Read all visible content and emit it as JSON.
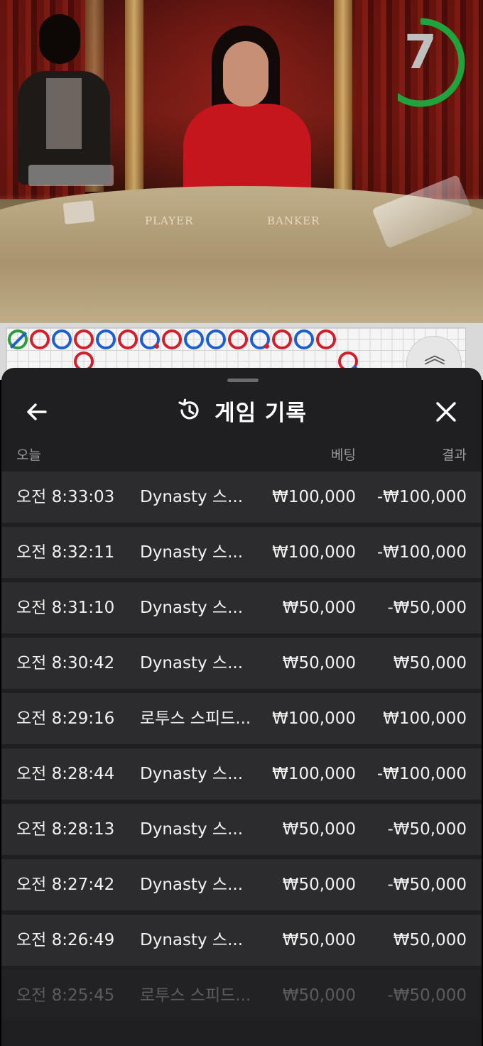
{
  "video": {
    "countdown": "7",
    "countdown_progress": 0.7,
    "table_labels": [
      "PLAYER",
      "BANKER"
    ]
  },
  "roadmap": {
    "row1": [
      "tie-slash",
      "red",
      "blue",
      "red",
      "blue",
      "red",
      "blue-dot",
      "red",
      "blue",
      "blue",
      "red",
      "blue-dot",
      "red",
      "blue",
      "red"
    ],
    "row2": [
      {
        "col": 3,
        "color": "red"
      },
      {
        "col": 15,
        "color": "red-dot"
      }
    ],
    "colors": {
      "player": "#1d5fd0",
      "banker": "#d21f2b",
      "tie": "#2b9b3b"
    }
  },
  "sheet": {
    "title": "게임 기록",
    "back_icon": "arrow-left-icon",
    "history_icon": "history-icon",
    "close_icon": "close-icon",
    "columns": {
      "date": "오늘",
      "bet": "베팅",
      "result": "결과"
    },
    "rows": [
      {
        "time": "오전 8:33:03",
        "game": "Dynasty 스...",
        "bet": "₩100,000",
        "result": "-₩100,000"
      },
      {
        "time": "오전 8:32:11",
        "game": "Dynasty 스...",
        "bet": "₩100,000",
        "result": "-₩100,000"
      },
      {
        "time": "오전 8:31:10",
        "game": "Dynasty 스...",
        "bet": "₩50,000",
        "result": "-₩50,000"
      },
      {
        "time": "오전 8:30:42",
        "game": "Dynasty 스...",
        "bet": "₩50,000",
        "result": "₩50,000"
      },
      {
        "time": "오전 8:29:16",
        "game": "로투스 스피드...",
        "bet": "₩100,000",
        "result": "₩100,000"
      },
      {
        "time": "오전 8:28:44",
        "game": "Dynasty 스...",
        "bet": "₩100,000",
        "result": "-₩100,000"
      },
      {
        "time": "오전 8:28:13",
        "game": "Dynasty 스...",
        "bet": "₩50,000",
        "result": "-₩50,000"
      },
      {
        "time": "오전 8:27:42",
        "game": "Dynasty 스...",
        "bet": "₩50,000",
        "result": "-₩50,000"
      },
      {
        "time": "오전 8:26:49",
        "game": "Dynasty 스...",
        "bet": "₩50,000",
        "result": "₩50,000"
      },
      {
        "time": "오전 8:25:45",
        "game": "로투스 스피드...",
        "bet": "₩50,000",
        "result": "-₩50,000"
      }
    ]
  }
}
